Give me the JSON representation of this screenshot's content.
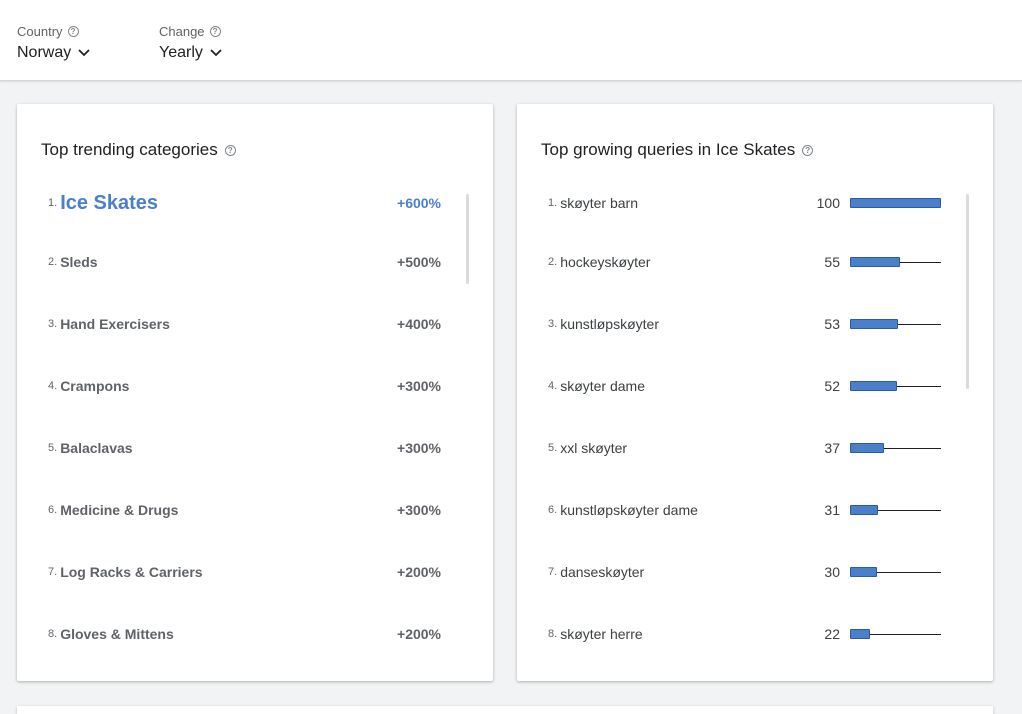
{
  "filters": {
    "country": {
      "label": "Country",
      "value": "Norway"
    },
    "change": {
      "label": "Change",
      "value": "Yearly"
    }
  },
  "help_glyph": "?",
  "categories_card": {
    "title": "Top trending categories",
    "items": [
      {
        "rank": "1.",
        "name": "Ice Skates",
        "change": "+600%"
      },
      {
        "rank": "2.",
        "name": "Sleds",
        "change": "+500%"
      },
      {
        "rank": "3.",
        "name": "Hand Exercisers",
        "change": "+400%"
      },
      {
        "rank": "4.",
        "name": "Crampons",
        "change": "+300%"
      },
      {
        "rank": "5.",
        "name": "Balaclavas",
        "change": "+300%"
      },
      {
        "rank": "6.",
        "name": "Medicine & Drugs",
        "change": "+300%"
      },
      {
        "rank": "7.",
        "name": "Log Racks & Carriers",
        "change": "+200%"
      },
      {
        "rank": "8.",
        "name": "Gloves & Mittens",
        "change": "+200%"
      }
    ]
  },
  "queries_card": {
    "title": "Top growing queries in Ice Skates",
    "items": [
      {
        "rank": "1.",
        "name": "skøyter barn",
        "value": "100"
      },
      {
        "rank": "2.",
        "name": "hockeyskøyter",
        "value": "55"
      },
      {
        "rank": "3.",
        "name": "kunstløpskøyter",
        "value": "53"
      },
      {
        "rank": "4.",
        "name": "skøyter dame",
        "value": "52"
      },
      {
        "rank": "5.",
        "name": "xxl skøyter",
        "value": "37"
      },
      {
        "rank": "6.",
        "name": "kunstløpskøyter dame",
        "value": "31"
      },
      {
        "rank": "7.",
        "name": "danseskøyter",
        "value": "30"
      },
      {
        "rank": "8.",
        "name": "skøyter herre",
        "value": "22"
      }
    ]
  },
  "colors": {
    "accent": "#4a7fca",
    "text_muted": "#5f6368"
  },
  "icons": {
    "help": "help-circle-icon",
    "dropdown": "chevron-down-icon"
  }
}
